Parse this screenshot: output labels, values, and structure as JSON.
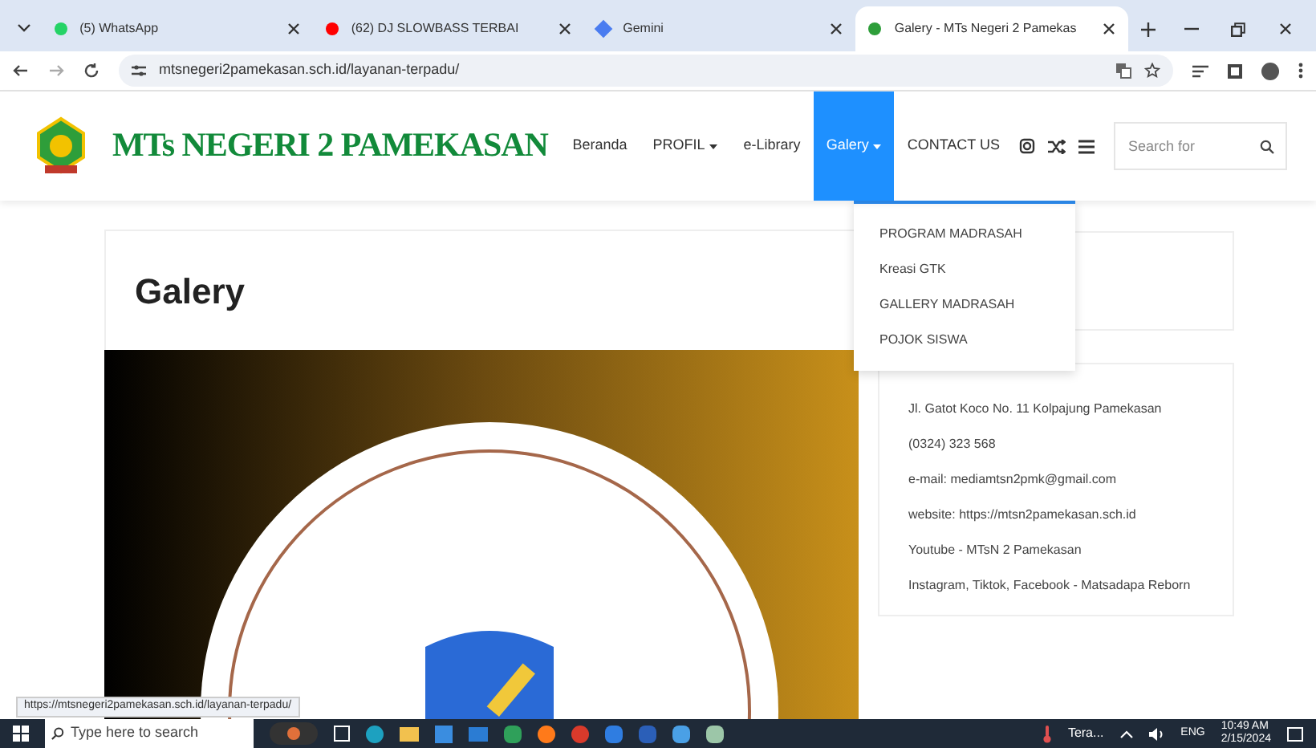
{
  "browser": {
    "tabs": [
      {
        "title": "(5) WhatsApp",
        "selected": false
      },
      {
        "title": "(62) DJ SLOWBASS TERBAI",
        "selected": false
      },
      {
        "title": "Gemini",
        "selected": false
      },
      {
        "title": "Galery - MTs Negeri 2 Pamekas",
        "selected": true
      }
    ],
    "url": "mtsnegeri2pamekasan.sch.id/layanan-terpadu/",
    "status_url": "https://mtsnegeri2pamekasan.sch.id/layanan-terpadu/"
  },
  "site": {
    "name": "MTs NEGERI 2 PAMEKASAN",
    "nav": [
      {
        "label": "Beranda",
        "dropdown": false,
        "selected": false
      },
      {
        "label": "PROFIL",
        "dropdown": true,
        "selected": false
      },
      {
        "label": "e-Library",
        "dropdown": false,
        "selected": false
      },
      {
        "label": "Galery",
        "dropdown": true,
        "selected": true
      },
      {
        "label": "CONTACT US",
        "dropdown": false,
        "selected": false
      }
    ],
    "search": {
      "placeholder": "Search for"
    },
    "dropdown_items": [
      "PROGRAM MADRASAH",
      "Kreasi GTK",
      "GALLERY MADRASAH",
      "POJOK SISWA"
    ]
  },
  "page": {
    "title": "Galery"
  },
  "contact": [
    "Jl. Gatot Koco No. 11 Kolpajung Pamekasan",
    "(0324) 323 568",
    "e-mail: mediamtsn2pmk@gmail.com",
    "website: https://mtsn2pamekasan.sch.id",
    "Youtube - MTsN 2 Pamekasan",
    "Instagram, Tiktok, Facebook - Matsadapa Reborn"
  ],
  "taskbar": {
    "search_placeholder": "Type here to search",
    "weather": "Tera...",
    "language": "ENG",
    "time": "10:49 AM",
    "date": "2/15/2024"
  }
}
